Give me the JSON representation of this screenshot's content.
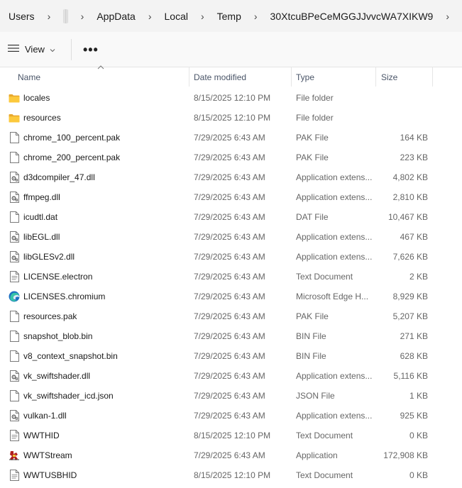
{
  "breadcrumb": {
    "items": [
      "Users",
      "",
      "AppData",
      "Local",
      "Temp",
      "30XtcuBPeCeMGGJJvvcWA7XIKW9"
    ],
    "separator": "›"
  },
  "toolbar": {
    "view_label": "View",
    "more_label": "•••"
  },
  "columns": {
    "name": "Name",
    "date": "Date modified",
    "type": "Type",
    "size": "Size"
  },
  "files": [
    {
      "name": "locales",
      "date": "8/15/2025 12:10 PM",
      "type": "File folder",
      "size": "",
      "icon": "folder-icon"
    },
    {
      "name": "resources",
      "date": "8/15/2025 12:10 PM",
      "type": "File folder",
      "size": "",
      "icon": "folder-icon"
    },
    {
      "name": "chrome_100_percent.pak",
      "date": "7/29/2025 6:43 AM",
      "type": "PAK File",
      "size": "164 KB",
      "icon": "file-icon"
    },
    {
      "name": "chrome_200_percent.pak",
      "date": "7/29/2025 6:43 AM",
      "type": "PAK File",
      "size": "223 KB",
      "icon": "file-icon"
    },
    {
      "name": "d3dcompiler_47.dll",
      "date": "7/29/2025 6:43 AM",
      "type": "Application extens...",
      "size": "4,802 KB",
      "icon": "dll-icon"
    },
    {
      "name": "ffmpeg.dll",
      "date": "7/29/2025 6:43 AM",
      "type": "Application extens...",
      "size": "2,810 KB",
      "icon": "dll-icon"
    },
    {
      "name": "icudtl.dat",
      "date": "7/29/2025 6:43 AM",
      "type": "DAT File",
      "size": "10,467 KB",
      "icon": "file-icon"
    },
    {
      "name": "libEGL.dll",
      "date": "7/29/2025 6:43 AM",
      "type": "Application extens...",
      "size": "467 KB",
      "icon": "dll-icon"
    },
    {
      "name": "libGLESv2.dll",
      "date": "7/29/2025 6:43 AM",
      "type": "Application extens...",
      "size": "7,626 KB",
      "icon": "dll-icon"
    },
    {
      "name": "LICENSE.electron",
      "date": "7/29/2025 6:43 AM",
      "type": "Text Document",
      "size": "2 KB",
      "icon": "text-file-icon"
    },
    {
      "name": "LICENSES.chromium",
      "date": "7/29/2025 6:43 AM",
      "type": "Microsoft Edge H...",
      "size": "8,929 KB",
      "icon": "edge-icon"
    },
    {
      "name": "resources.pak",
      "date": "7/29/2025 6:43 AM",
      "type": "PAK File",
      "size": "5,207 KB",
      "icon": "file-icon"
    },
    {
      "name": "snapshot_blob.bin",
      "date": "7/29/2025 6:43 AM",
      "type": "BIN File",
      "size": "271 KB",
      "icon": "file-icon"
    },
    {
      "name": "v8_context_snapshot.bin",
      "date": "7/29/2025 6:43 AM",
      "type": "BIN File",
      "size": "628 KB",
      "icon": "file-icon"
    },
    {
      "name": "vk_swiftshader.dll",
      "date": "7/29/2025 6:43 AM",
      "type": "Application extens...",
      "size": "5,116 KB",
      "icon": "dll-icon"
    },
    {
      "name": "vk_swiftshader_icd.json",
      "date": "7/29/2025 6:43 AM",
      "type": "JSON File",
      "size": "1 KB",
      "icon": "file-icon"
    },
    {
      "name": "vulkan-1.dll",
      "date": "7/29/2025 6:43 AM",
      "type": "Application extens...",
      "size": "925 KB",
      "icon": "dll-icon"
    },
    {
      "name": "WWTHID",
      "date": "8/15/2025 12:10 PM",
      "type": "Text Document",
      "size": "0 KB",
      "icon": "text-file-icon"
    },
    {
      "name": "WWTStream",
      "date": "7/29/2025 6:43 AM",
      "type": "Application",
      "size": "172,908 KB",
      "icon": "app-icon"
    },
    {
      "name": "WWTUSBHID",
      "date": "8/15/2025 12:10 PM",
      "type": "Text Document",
      "size": "0 KB",
      "icon": "text-file-icon"
    }
  ]
}
